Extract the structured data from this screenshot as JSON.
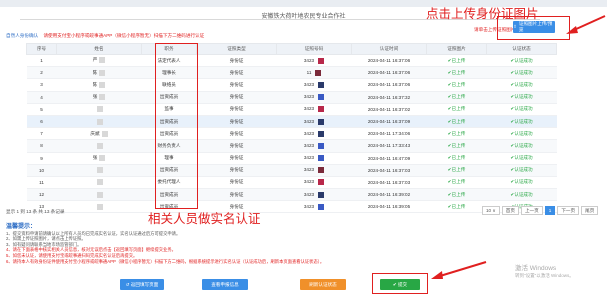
{
  "page": {
    "coop_title": "安徽铁大荷叶地农民专业合作社",
    "annotation_top": "点击上传身份证图片",
    "annotation_middle": "相关人员做实名认证"
  },
  "hint": {
    "left_link": "自然人身份确认",
    "red_text": "请使用支付宝小程序或皖事通APP（微信小程序暂无）扫描下方二维码进行认证"
  },
  "upload": {
    "hint": "请单击上传证照图片",
    "button": "证照图片上传/预览",
    "icon": "upload-icon"
  },
  "table": {
    "headers": [
      "序号",
      "姓名",
      "职务",
      "证照类型",
      "证照号码",
      "认证时间",
      "证照图片",
      "认证状态"
    ],
    "rows": [
      {
        "no": "1",
        "name": "严",
        "role": "法定代表人",
        "idtype": "身份证",
        "idno": "3423",
        "time": "2024-04-11 16:37:06",
        "photo": "✔已上传",
        "status": "✔认证成功",
        "sw": "#b8284a"
      },
      {
        "no": "2",
        "name": "陈",
        "role": "理事长",
        "idtype": "身份证",
        "idno": "11",
        "time": "2024-04-11 16:37:06",
        "photo": "✔已上传",
        "status": "✔认证成功",
        "sw": "#7b2a3a"
      },
      {
        "no": "3",
        "name": "陈",
        "role": "联络员",
        "idtype": "身份证",
        "idno": "3423",
        "time": "2024-04-11 16:37:06",
        "photo": "✔已上传",
        "status": "✔认证成功",
        "sw": "#2a3a6a"
      },
      {
        "no": "4",
        "name": "张",
        "role": "出资成员",
        "idtype": "身份证",
        "idno": "3423",
        "time": "2024-04-11 16:37:32",
        "photo": "✔已上传",
        "status": "✔认证成功",
        "sw": "#3a5ac4"
      },
      {
        "no": "5",
        "name": "",
        "role": "监事",
        "idtype": "身份证",
        "idno": "3423",
        "time": "2024-04-11 16:37:02",
        "photo": "✔已上传",
        "status": "✔认证成功",
        "sw": "#b8284a"
      },
      {
        "no": "6",
        "name": "",
        "role": "出资成员",
        "idtype": "身份证",
        "idno": "3423",
        "time": "2024-04-11 16:37:09",
        "photo": "✔已上传",
        "status": "✔认证成功",
        "sw": "#2a3a6a"
      },
      {
        "no": "7",
        "name": "庆斌",
        "role": "出资成员",
        "idtype": "身份证",
        "idno": "3423",
        "time": "2024-04-11 17:34:06",
        "photo": "✔已上传",
        "status": "✔认证成功",
        "sw": "#2a3a6a"
      },
      {
        "no": "8",
        "name": "",
        "role": "财务负责人",
        "idtype": "身份证",
        "idno": "3423",
        "time": "2024-04-11 17:33:43",
        "photo": "✔已上传",
        "status": "✔认证成功",
        "sw": "#3a5ac4"
      },
      {
        "no": "9",
        "name": "张",
        "role": "理事",
        "idtype": "身份证",
        "idno": "3423",
        "time": "2024-04-11 16:47:09",
        "photo": "✔已上传",
        "status": "✔认证成功",
        "sw": "#3a5ac4"
      },
      {
        "no": "10",
        "name": "",
        "role": "出资成员",
        "idtype": "身份证",
        "idno": "3423",
        "time": "2024-04-11 16:37:03",
        "photo": "✔已上传",
        "status": "✔认证成功",
        "sw": "#7b2a3a"
      },
      {
        "no": "11",
        "name": "",
        "role": "委托代理人",
        "idtype": "身份证",
        "idno": "3423",
        "time": "2024-04-11 16:37:03",
        "photo": "✔已上传",
        "status": "✔认证成功",
        "sw": "#b8284a"
      },
      {
        "no": "12",
        "name": "",
        "role": "出资成员",
        "idtype": "身份证",
        "idno": "3423",
        "time": "2024-04-11 16:39:02",
        "photo": "✔已上传",
        "status": "✔认证成功",
        "sw": "#2a3a6a"
      },
      {
        "no": "13",
        "name": "",
        "role": "出资成员",
        "idtype": "身份证",
        "idno": "3423",
        "time": "2024-04-11 16:39:05",
        "photo": "✔已上传",
        "status": "✔认证成功",
        "sw": "#3a5ac4"
      }
    ]
  },
  "footer": {
    "info": "显示 1 到 13 条 共 13 条记录",
    "page_size": "10 ∨",
    "first": "首页",
    "prev": "上一页",
    "current": "1",
    "next": "下一页",
    "last": "尾页"
  },
  "notes": {
    "title": "温馨提示：",
    "l1": "1、提交资料申请前请确认以上所有人员均已完成实名认证，实名认证通过后方可提交申请。",
    "l2": "2、如需上传证照图片，请点击上传证照。",
    "l3": "3、如有疑问请联系当地市场监管部门。",
    "l4": "4、请在下面表格中核实相关人员信息，核对无误后点击【返回填写页面】继续提交业务。",
    "l5": "5、如您未认证，请使用支付宝或皖事通扫码完成实名认证后再提交。",
    "l6": "6、请持本人有效身份证件使用支付宝小程序或皖事通APP（微信小程序暂无）扫描下方二维码，根据系统提示进行实名认证（认证成功后，刷新本页面查看认证状态）。"
  },
  "buttons": {
    "back": "↺ 返回填写页面",
    "view": "查看申报信息",
    "refresh": "刷新认证状态",
    "submit": "✔ 提交"
  },
  "windows": {
    "title": "激活 Windows",
    "sub": "转到\"设置\"以激活 Windows。"
  }
}
